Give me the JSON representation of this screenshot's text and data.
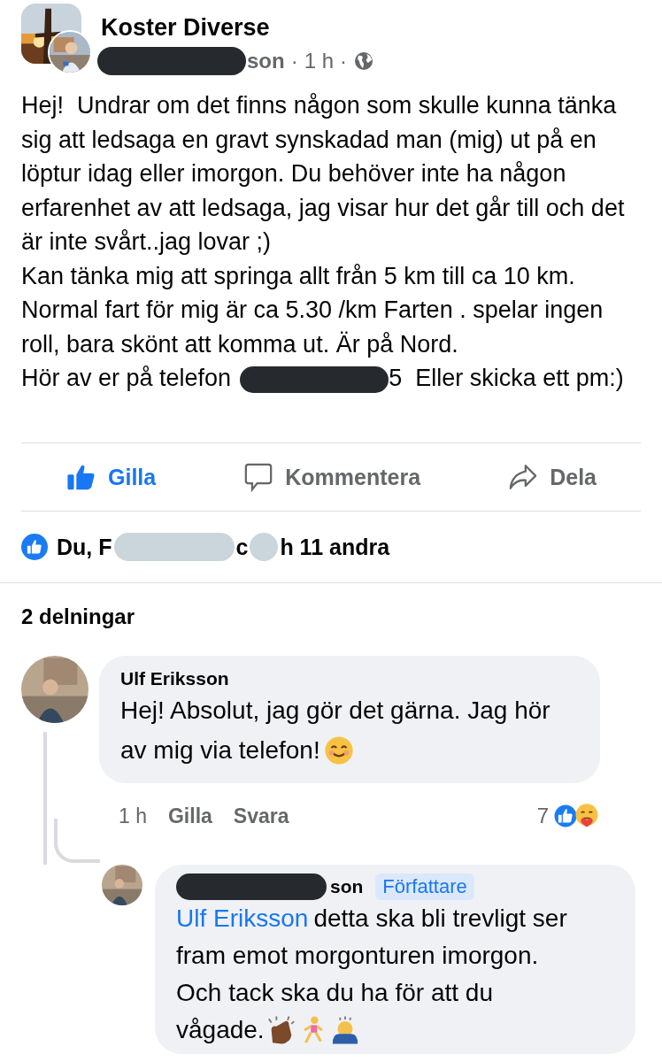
{
  "post": {
    "group": "Koster Diverse",
    "author_suffix": "son",
    "time": "1 h",
    "separator": "·",
    "paragraphs": [
      "Hej!  Undrar om det finns någon som skulle kunna tänka sig att ledsaga en gravt synskadad man (mig) ut på en löptur idag eller imorgon. Du behöver inte ha någon erfarenhet av att ledsaga, jag visar hur det går till och det är inte svårt..jag lovar ;)",
      "Kan tänka mig att springa allt från 5 km till ca 10 km. Normal fart för mig är ca 5.30 /km Farten . spelar ingen roll, bara skönt att komma ut. Är på Nord."
    ],
    "phone_line": {
      "before": "Hör av er på telefon",
      "after": "5  Eller skicka ett pm:)"
    }
  },
  "actions": [
    {
      "kind": "like",
      "label": "Gilla",
      "selected": true
    },
    {
      "kind": "comment",
      "label": "Kommentera",
      "selected": false
    },
    {
      "kind": "share",
      "label": "Dela",
      "selected": false
    }
  ],
  "reactions": {
    "before": "Du, F",
    "middle": "c",
    "after": "h 11 andra"
  },
  "shares": "2 delningar",
  "comment": {
    "name": "Ulf Eriksson",
    "lines": [
      "Hej! Absolut, jag gör det gärna. Jag hör",
      "av mig via telefon!"
    ],
    "time": "1 h",
    "links": [
      "Gilla",
      "Svara"
    ],
    "reaction_count": "7"
  },
  "reply": {
    "name_suffix": "son",
    "badge": "Författare",
    "mention": "Ulf Eriksson",
    "lines": [
      "detta ska bli trevligt ser",
      "fram emot morgonturen imorgon.",
      "Och tack ska du ha för att du",
      "vågade."
    ]
  }
}
